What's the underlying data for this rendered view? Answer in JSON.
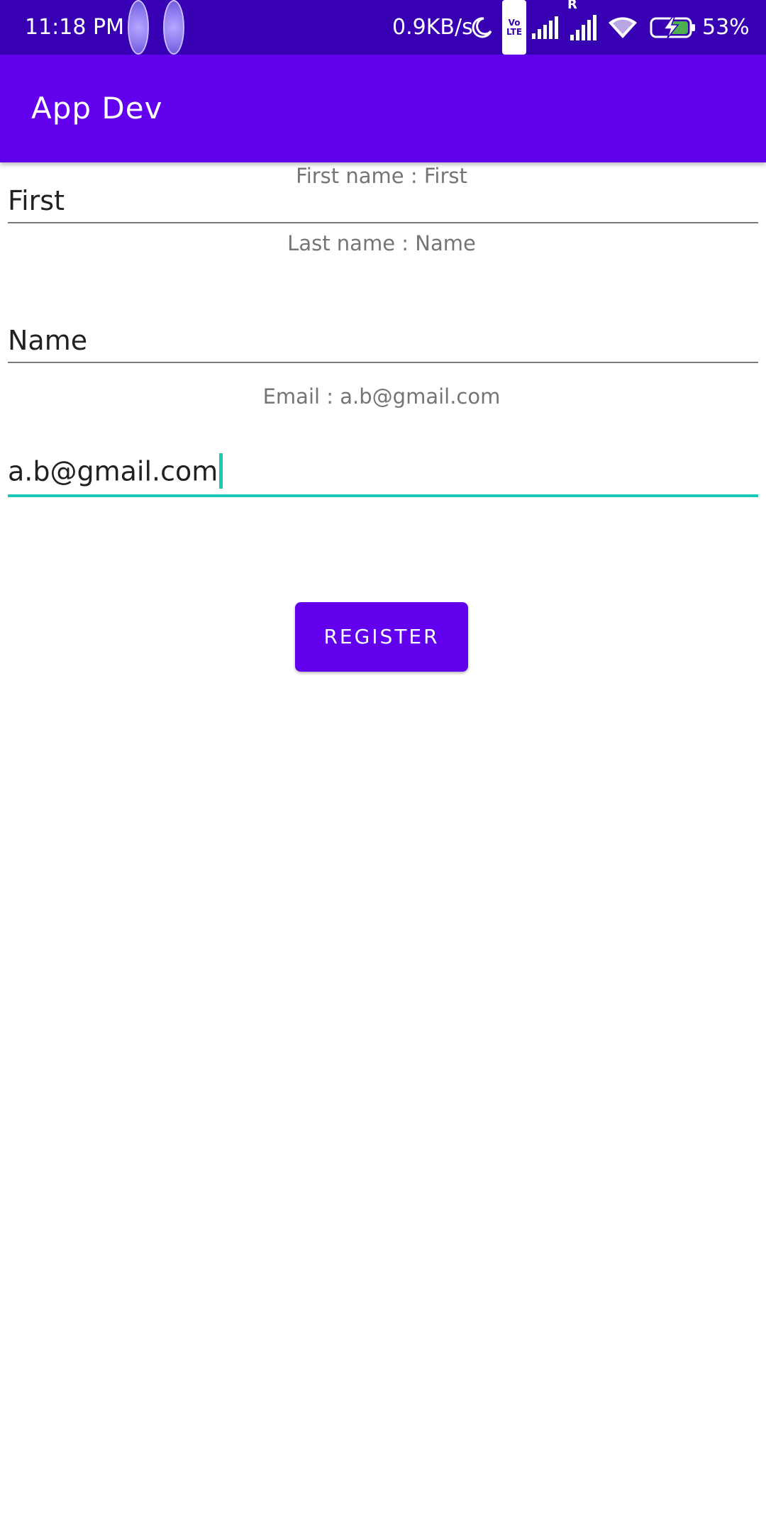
{
  "status_bar": {
    "time": "11:18 PM",
    "speed": "0.9KB/s",
    "volte_line1": "Vo",
    "volte_line2": "LTE",
    "roaming": "R",
    "battery_percent": "53%",
    "battery_level": 0.53,
    "icons": [
      "notification-dot-icon",
      "notification-dot-icon",
      "moon-icon",
      "volte-icon",
      "signal-icon",
      "signal-roaming-icon",
      "wifi-icon",
      "battery-charging-icon"
    ]
  },
  "app_bar": {
    "title": "App Dev"
  },
  "form": {
    "first_label": "First name : First",
    "first_value": "First",
    "last_label": "Last name : Name",
    "last_value": "Name",
    "email_label": "Email : a.b@gmail.com",
    "email_value": "a.b@gmail.com"
  },
  "register_button": {
    "label": "Register"
  },
  "colors": {
    "status_bar": "#3700B3",
    "primary": "#6200EE",
    "accent": "#1BC7B7",
    "battery_fill": "#4CAF50"
  }
}
